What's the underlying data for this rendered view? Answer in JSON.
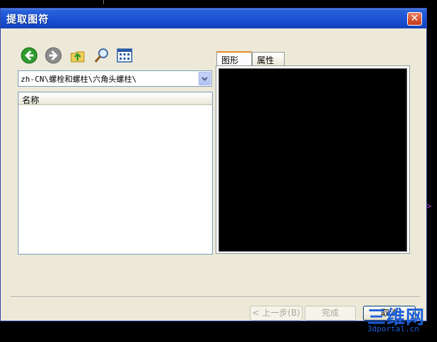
{
  "window": {
    "title": "提取图符",
    "close_glyph": "✕"
  },
  "toolbar": {
    "icons": [
      "back-icon",
      "forward-icon",
      "up-folder-icon",
      "search-icon",
      "view-icon"
    ],
    "colors": {
      "back": "#2e9b2e",
      "forward": "#8c8c8c",
      "up": "#e2b620"
    }
  },
  "path_combo": {
    "value": "zh-CN\\螺栓和螺柱\\六角头螺柱\\"
  },
  "list": {
    "columns": [
      "名称"
    ],
    "rows": []
  },
  "tabs": [
    {
      "label": "图形",
      "active": true
    },
    {
      "label": "属性",
      "active": false
    }
  ],
  "buttons": {
    "back": "< 上一步(B)",
    "finish": "完成",
    "cancel": "取消"
  },
  "watermark": {
    "big": "三维网",
    "small": "3dportal.cn"
  },
  "side_mark": ">"
}
